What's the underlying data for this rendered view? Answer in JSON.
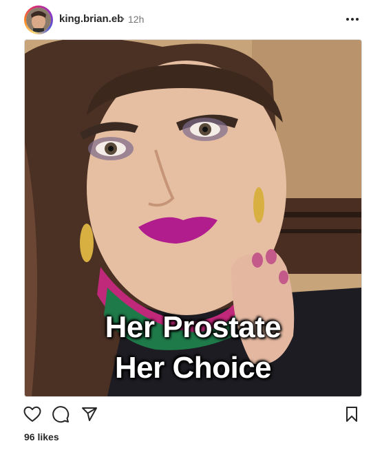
{
  "post": {
    "username": "king.brian.eb",
    "separator": "•",
    "time": "12h",
    "image_caption": {
      "line1": "Her Prostate",
      "line2": "Her Choice"
    },
    "likes": "96 likes"
  },
  "icons": {
    "more": "more-horizontal-icon",
    "like": "heart-icon",
    "comment": "comment-icon",
    "share": "send-icon",
    "save": "bookmark-icon"
  },
  "colors": {
    "text": "#262626",
    "muted": "#737373",
    "story_ring": [
      "#feda75",
      "#fa7e1e",
      "#d62976",
      "#962fbf",
      "#4f5bd5"
    ]
  }
}
